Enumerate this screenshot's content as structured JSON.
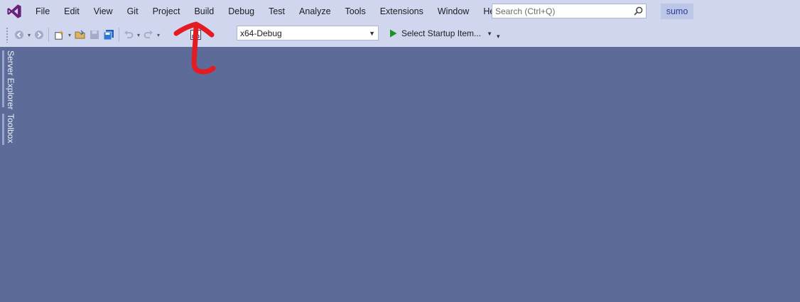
{
  "menu": {
    "items": [
      "File",
      "Edit",
      "View",
      "Git",
      "Project",
      "Build",
      "Debug",
      "Test",
      "Analyze",
      "Tools",
      "Extensions",
      "Window",
      "Help"
    ]
  },
  "search": {
    "placeholder": "Search (Ctrl+Q)",
    "icon": "search-icon"
  },
  "solution_name": "sumo",
  "toolbar": {
    "configuration": "x64-Debug",
    "startup_label": "Select Startup Item...",
    "play_color": "#1e8f26"
  },
  "side_tabs": {
    "server_explorer": "Server Explorer",
    "toolbox": "Toolbox"
  },
  "colors": {
    "menubar_bg": "#cfd6ee",
    "workspace_bg": "#5d6b99",
    "logo": "#68217a",
    "annotation_arrow": "#e31b23"
  }
}
